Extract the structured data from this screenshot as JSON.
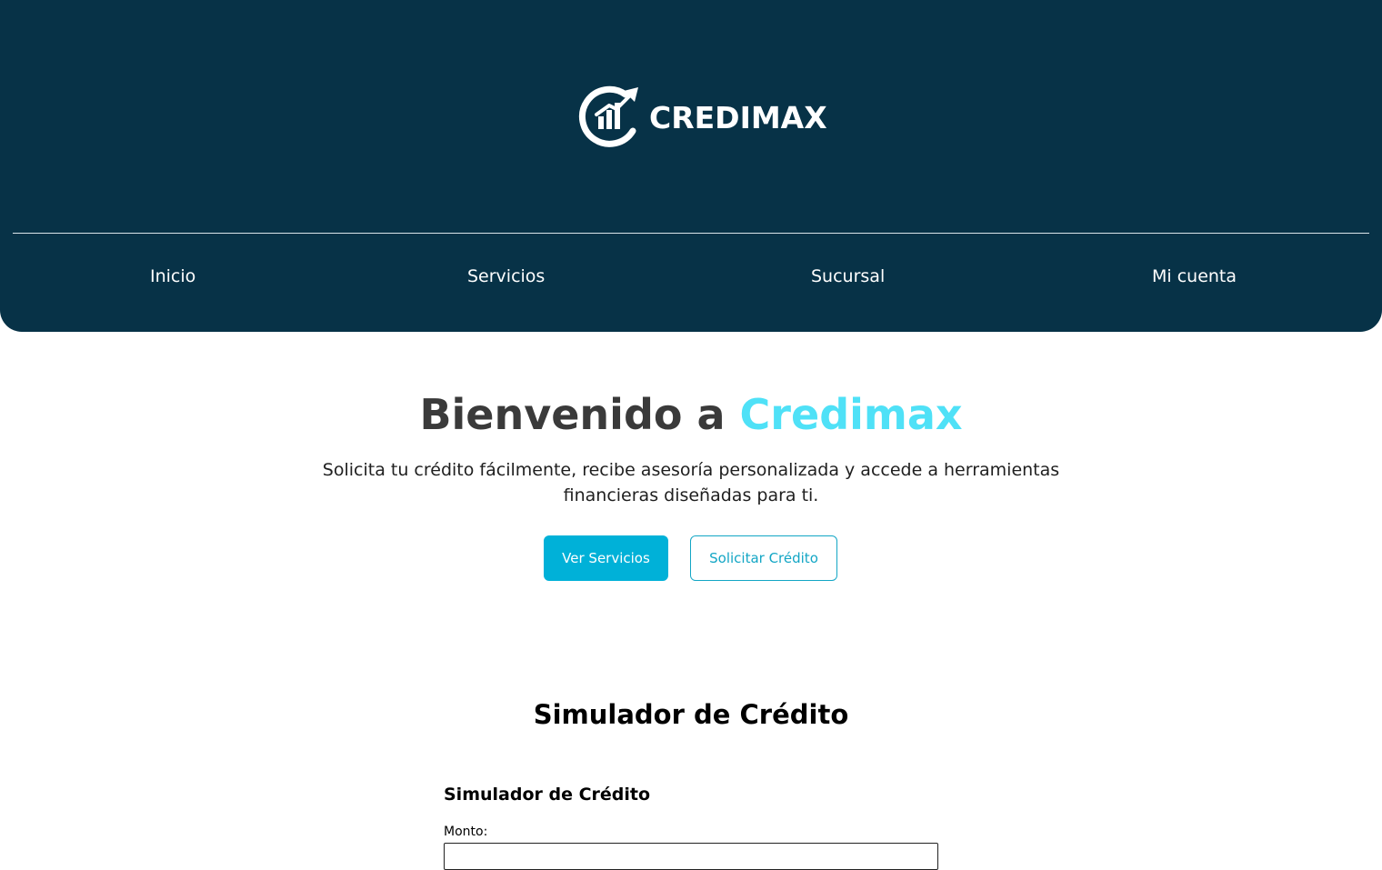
{
  "brand": {
    "name": "CREDIMAX",
    "logo_icon": "growth-chart-arrow-circle-icon",
    "colors": {
      "header_bg": "#073247",
      "accent": "#4fe1f7",
      "primary_button": "#00b1d8",
      "outline_button": "#13a6c5"
    }
  },
  "nav": {
    "items": [
      {
        "label": "Inicio"
      },
      {
        "label": "Servicios"
      },
      {
        "label": "Sucursal"
      },
      {
        "label": "Mi cuenta"
      }
    ]
  },
  "hero": {
    "title_prefix": "Bienvenido a ",
    "title_accent": "Credimax",
    "subtitle": "Solicita tu crédito fácilmente, recibe asesoría personalizada y accede a herramientas financieras diseñadas para ti.",
    "primary_button": "Ver Servicios",
    "secondary_button": "Solicitar Crédito"
  },
  "simulator": {
    "section_title": "Simulador de Crédito",
    "card_title": "Simulador de Crédito",
    "amount_label": "Monto:",
    "amount_value": ""
  }
}
